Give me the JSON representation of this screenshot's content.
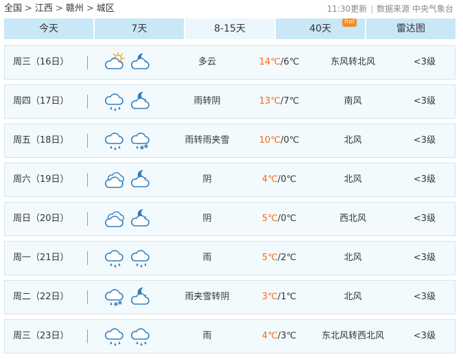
{
  "breadcrumb": {
    "items": [
      "全国",
      "江西",
      "赣州",
      "城区"
    ],
    "separator": ">"
  },
  "meta": {
    "updated": "11:30更新",
    "source": "数据来源 中央气象台"
  },
  "tabs": [
    {
      "label": "今天",
      "active": false,
      "hot": ""
    },
    {
      "label": "7天",
      "active": false,
      "hot": ""
    },
    {
      "label": "8-15天",
      "active": true,
      "hot": ""
    },
    {
      "label": "40天",
      "active": false,
      "hot": "hot"
    },
    {
      "label": "雷达图",
      "active": false,
      "hot": ""
    }
  ],
  "colors": {
    "tab_bg": "#c8e7f7",
    "tab_active_bg": "#ecf7fd",
    "row_bg": "#f3fafe",
    "row_border": "#cfe3ef",
    "temp_high": "#f2691c",
    "icon_blue": "#2f7fbf",
    "icon_sun": "#f0a020",
    "hot_badge": "#f38a22"
  },
  "forecast": [
    {
      "day": "周三（16日）",
      "icons": [
        "partly-cloudy-sun-icon",
        "partly-cloudy-moon-icon"
      ],
      "desc": "多云",
      "high": "14℃",
      "low": "6℃",
      "wind": "东风转北风",
      "level": "<3级"
    },
    {
      "day": "周四（17日）",
      "icons": [
        "rain-icon",
        "cloudy-moon-icon"
      ],
      "desc": "雨转阴",
      "high": "13℃",
      "low": "7℃",
      "wind": "南风",
      "level": "<3级"
    },
    {
      "day": "周五（18日）",
      "icons": [
        "rain-icon",
        "sleet-icon"
      ],
      "desc": "雨转雨夹雪",
      "high": "10℃",
      "low": "0℃",
      "wind": "北风",
      "level": "<3级"
    },
    {
      "day": "周六（19日）",
      "icons": [
        "overcast-icon",
        "cloudy-moon-icon"
      ],
      "desc": "阴",
      "high": "4℃",
      "low": "0℃",
      "wind": "北风",
      "level": "<3级"
    },
    {
      "day": "周日（20日）",
      "icons": [
        "overcast-icon",
        "cloudy-moon-icon"
      ],
      "desc": "阴",
      "high": "5℃",
      "low": "0℃",
      "wind": "西北风",
      "level": "<3级"
    },
    {
      "day": "周一（21日）",
      "icons": [
        "rain-icon",
        "rain-icon"
      ],
      "desc": "雨",
      "high": "5℃",
      "low": "2℃",
      "wind": "北风",
      "level": "<3级"
    },
    {
      "day": "周二（22日）",
      "icons": [
        "sleet-icon",
        "cloudy-moon-icon"
      ],
      "desc": "雨夹雪转阴",
      "high": "3℃",
      "low": "1℃",
      "wind": "北风",
      "level": "<3级"
    },
    {
      "day": "周三（23日）",
      "icons": [
        "rain-icon",
        "rain-icon"
      ],
      "desc": "雨",
      "high": "4℃",
      "low": "3℃",
      "wind": "东北风转西北风",
      "level": "<3级"
    }
  ]
}
